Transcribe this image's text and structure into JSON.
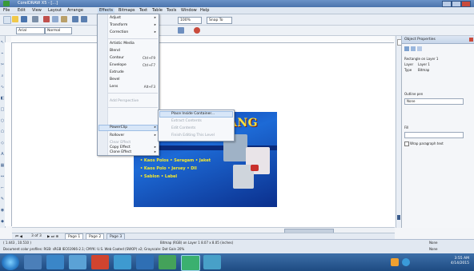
{
  "window": {
    "title": "CorelDRAW X5 - [...]"
  },
  "menubar": [
    "File",
    "Edit",
    "View",
    "Layout",
    "Arrange",
    "Effects",
    "Bitmaps",
    "Text",
    "Table",
    "Tools",
    "Window",
    "Help"
  ],
  "toolbar": {
    "zoom": "100%",
    "snap_to": "Snap To",
    "font_combo": "Arial",
    "size_combo": "Normal"
  },
  "effects_menu": {
    "items": [
      {
        "label": "Adjust",
        "arrow": true
      },
      {
        "label": "Transform",
        "arrow": true
      },
      {
        "label": "Correction",
        "arrow": true
      },
      {
        "label": "Artistic Media",
        "shortcut": ""
      },
      {
        "label": "Blend",
        "shortcut": ""
      },
      {
        "label": "Contour",
        "shortcut": "Ctrl+F9"
      },
      {
        "label": "Envelope",
        "shortcut": "Ctrl+F7"
      },
      {
        "label": "Extrude",
        "shortcut": ""
      },
      {
        "label": "Bevel",
        "shortcut": ""
      },
      {
        "label": "Lens",
        "shortcut": "Alt+F3"
      },
      {
        "label": "Add Perspective",
        "disabled": true
      },
      {
        "label": "PowerClip",
        "arrow": true,
        "highlighted": true
      },
      {
        "label": "Rollover",
        "arrow": true
      },
      {
        "label": "Clear Effect",
        "disabled": true
      },
      {
        "label": "Copy Effect",
        "arrow": true
      },
      {
        "label": "Clone Effect",
        "arrow": true
      }
    ]
  },
  "powerclip_submenu": {
    "items": [
      {
        "label": "Place Inside Container...",
        "highlighted": true
      },
      {
        "label": "Extract Contents",
        "disabled": true
      },
      {
        "label": "Edit Contents",
        "disabled": true
      },
      {
        "label": "Finish Editing This Level",
        "disabled": true
      }
    ]
  },
  "artwork": {
    "title": "ANG",
    "lines": [
      "• Kaos Polos  • Seragam  • Jaket",
      "• Kaos Polo   • Jersey   • Dll",
      "• Sablon      • Label"
    ]
  },
  "docker": {
    "title": "Object Properties",
    "rows": [
      {
        "label": "Rectangle on Layer 1",
        "value": ""
      },
      {
        "label": "Layer",
        "value": "Layer 1"
      },
      {
        "label": "Type",
        "value": "Bitmap"
      }
    ],
    "outline_label": "Outline pen",
    "outline_value": "None",
    "fill_label": "Fill",
    "checkbox_label": "Wrap paragraph text"
  },
  "pagenav": {
    "counter": "3 of 3",
    "tabs": [
      "Page 1",
      "Page 2",
      "Page 3"
    ]
  },
  "status": {
    "coords": "( 1.443 , 10.510 )",
    "object": "Bitmap (RGB) on Layer 1 8.07 x 8.05 (inches)",
    "hint": "Document color profiles: RGB: sRGB IEC61966-2.1; CMYK: U.S. Web Coated (SWOP) v2; Grayscale: Dot Gain 20%",
    "fill_label": "None",
    "outline_label": "None"
  },
  "taskbar": {
    "time": "3:55 AM",
    "date": "4/14/2015"
  },
  "colors": {
    "accent": "#3d6fa8",
    "menu_highlight": "#d7e6f8",
    "art_text": "#f7ea2c"
  }
}
